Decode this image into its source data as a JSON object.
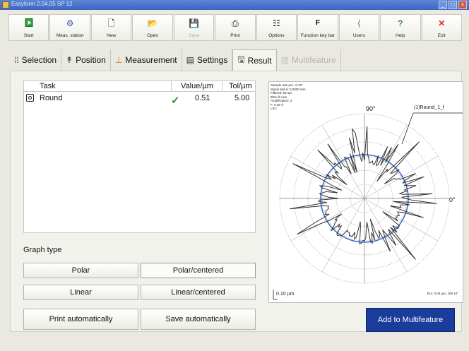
{
  "window": {
    "title": "Easyform 2.04.05 SP 12"
  },
  "toolbar": [
    {
      "label": "Start",
      "icon": "start-icon"
    },
    {
      "label": "Meas. station",
      "icon": "station-icon"
    },
    {
      "label": "New",
      "icon": "new-icon"
    },
    {
      "label": "Open",
      "icon": "open-icon"
    },
    {
      "label": "Save",
      "icon": "save-icon",
      "disabled": true
    },
    {
      "label": "Print",
      "icon": "print-icon"
    },
    {
      "label": "Options",
      "icon": "options-icon"
    },
    {
      "label": "Function key bar",
      "icon": "function-key-icon"
    },
    {
      "label": "Users",
      "icon": "users-icon"
    },
    {
      "label": "Help",
      "icon": "help-icon"
    },
    {
      "label": "Exit",
      "icon": "exit-icon"
    }
  ],
  "tabs": [
    {
      "label": "Selection",
      "icon": "selection-icon"
    },
    {
      "label": "Position",
      "icon": "position-icon"
    },
    {
      "label": "Measurement",
      "icon": "measurement-icon"
    },
    {
      "label": "Settings",
      "icon": "settings-icon"
    },
    {
      "label": "Result",
      "icon": "result-icon",
      "active": true
    },
    {
      "label": "Multifeature",
      "icon": "multifeature-icon",
      "disabled": true
    }
  ],
  "tasklist": {
    "headers": {
      "task": "Task",
      "value": "Value/µm",
      "tol": "Tol/µm"
    },
    "rows": [
      {
        "task": "Round",
        "value": "0.51",
        "tol": "5.00",
        "status": "ok"
      }
    ]
  },
  "graph_type": {
    "label": "Graph type",
    "buttons": {
      "polar": "Polar",
      "polar_centered": "Polar/centered",
      "linear": "Linear",
      "linear_centered": "Linear/centered",
      "print_auto": "Print automatically",
      "save_auto": "Save automatically"
    },
    "selected": "Polar/centered"
  },
  "plot": {
    "info_lines": [
      "Sample rate pol.: 0.18°",
      "Stylus ball ø: 0.0000 mm",
      "Filtered: 50 upr",
      "80% ill.core",
      "Amplification: 2",
      "F: 0.00 ©",
      "LSC"
    ],
    "label_90": "90°",
    "label_0": "0°",
    "legend": "(1)Round_1_f",
    "scale": "0.10 µm",
    "footer": "Ecc: 0.04 µm, 108.14°",
    "colors": {
      "trace": "#333333",
      "reference": "#3a6fd8",
      "grid": "#9a9a9a"
    }
  },
  "actions": {
    "add_multifeature": "Add to Multifeature"
  },
  "colors": {
    "accent": "#1a3d9b",
    "ok": "#2b9a2b"
  }
}
